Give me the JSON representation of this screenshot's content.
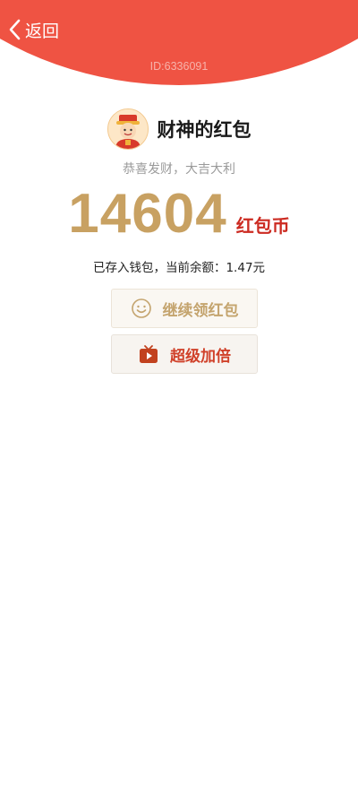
{
  "header": {
    "back_label": "返回",
    "id_text": "ID:6336091"
  },
  "sender": {
    "name": "财神的红包"
  },
  "greeting": "恭喜发财，大吉大利",
  "reward": {
    "amount": "14604",
    "unit": "红包币"
  },
  "wallet_line": "已存入钱包，当前余额：1.47元",
  "buttons": {
    "continue_label": "继续领红包",
    "double_label": "超级加倍"
  },
  "colors": {
    "header_red": "#ef5343",
    "amount_gold": "#c8a162",
    "unit_red": "#cc2b22"
  },
  "icons": {
    "back": "chevron-left-icon",
    "continue": "smiley-icon",
    "double": "video-play-icon"
  }
}
